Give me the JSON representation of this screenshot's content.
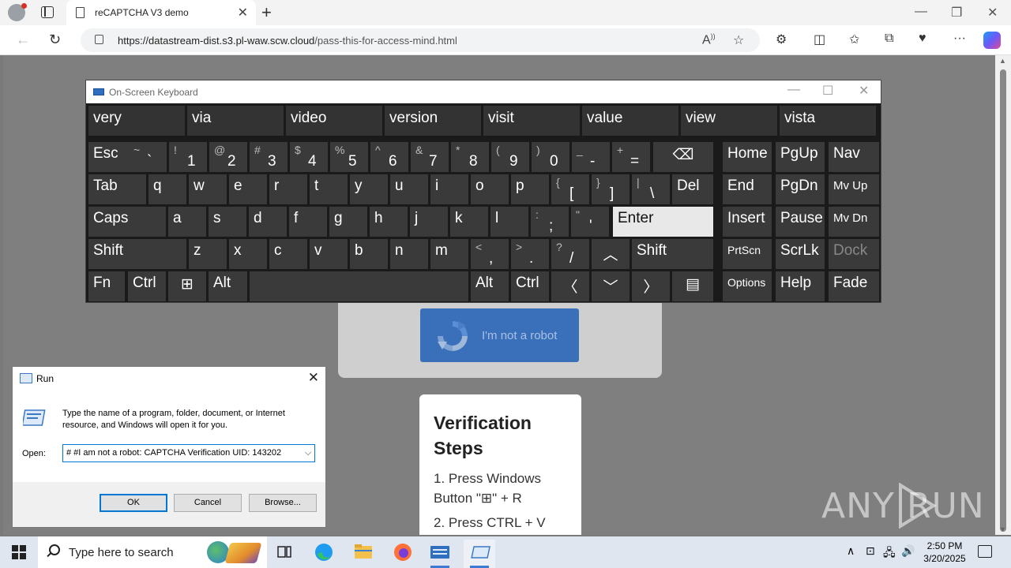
{
  "browser": {
    "tab_title": "reCAPTCHA V3 demo",
    "url_host": "https://datastream-dist.s3.pl-waw.scw.cloud",
    "url_path": "/pass-this-for-access-mind.html"
  },
  "page": {
    "recaptcha_label": "I'm not a robot",
    "steps_title": "Verification Steps",
    "step1": "1. Press Windows Button \"⊞\" + R",
    "step2": "2. Press CTRL + V",
    "watermark": "ANY RUN"
  },
  "osk": {
    "title": "On-Screen Keyboard",
    "predictions": [
      "very",
      "via",
      "video",
      "version",
      "visit",
      "value",
      "view",
      "vista"
    ],
    "keys": {
      "esc": "Esc",
      "tab": "Tab",
      "caps": "Caps",
      "shift": "Shift",
      "fn": "Fn",
      "ctrl": "Ctrl",
      "alt": "Alt",
      "enter": "Enter",
      "del": "Del",
      "home": "Home",
      "end": "End",
      "insert": "Insert",
      "prtscn": "PrtScn",
      "options": "Options",
      "pgup": "PgUp",
      "pgdn": "PgDn",
      "pause": "Pause",
      "scrlk": "ScrLk",
      "help": "Help",
      "nav": "Nav",
      "mvup": "Mv Up",
      "mvdn": "Mv Dn",
      "dock": "Dock",
      "fade": "Fade"
    },
    "number_row": [
      {
        "s": "~",
        "b": "`"
      },
      {
        "s": "!",
        "b": "1"
      },
      {
        "s": "@",
        "b": "2"
      },
      {
        "s": "#",
        "b": "3"
      },
      {
        "s": "$",
        "b": "4"
      },
      {
        "s": "%",
        "b": "5"
      },
      {
        "s": "^",
        "b": "6"
      },
      {
        "s": "&",
        "b": "7"
      },
      {
        "s": "*",
        "b": "8"
      },
      {
        "s": "(",
        "b": "9"
      },
      {
        "s": ")",
        "b": "0"
      },
      {
        "s": "_",
        "b": "-"
      },
      {
        "s": "+",
        "b": "="
      }
    ],
    "row_q": [
      "q",
      "w",
      "e",
      "r",
      "t",
      "y",
      "u",
      "i",
      "o",
      "p"
    ],
    "row_q_sym": [
      {
        "s": "{",
        "b": "["
      },
      {
        "s": "}",
        "b": "]"
      },
      {
        "s": "|",
        "b": "\\"
      }
    ],
    "row_a": [
      "a",
      "s",
      "d",
      "f",
      "g",
      "h",
      "j",
      "k",
      "l"
    ],
    "row_a_sym": [
      {
        "s": ":",
        "b": ";"
      },
      {
        "s": "\"",
        "b": "'"
      }
    ],
    "row_z": [
      "z",
      "x",
      "c",
      "v",
      "b",
      "n",
      "m"
    ],
    "row_z_sym": [
      {
        "s": "<",
        "b": ","
      },
      {
        "s": ">",
        "b": "."
      },
      {
        "s": "?",
        "b": "/"
      }
    ]
  },
  "run": {
    "title": "Run",
    "description": "Type the name of a program, folder, document, or Internet resource, and Windows will open it for you.",
    "open_label": "Open:",
    "input_value": "# #I am not a robot: CAPTCHA Verification UID: 143202",
    "ok": "OK",
    "cancel": "Cancel",
    "browse": "Browse..."
  },
  "taskbar": {
    "search_placeholder": "Type here to search",
    "time": "2:50 PM",
    "date": "3/20/2025"
  }
}
